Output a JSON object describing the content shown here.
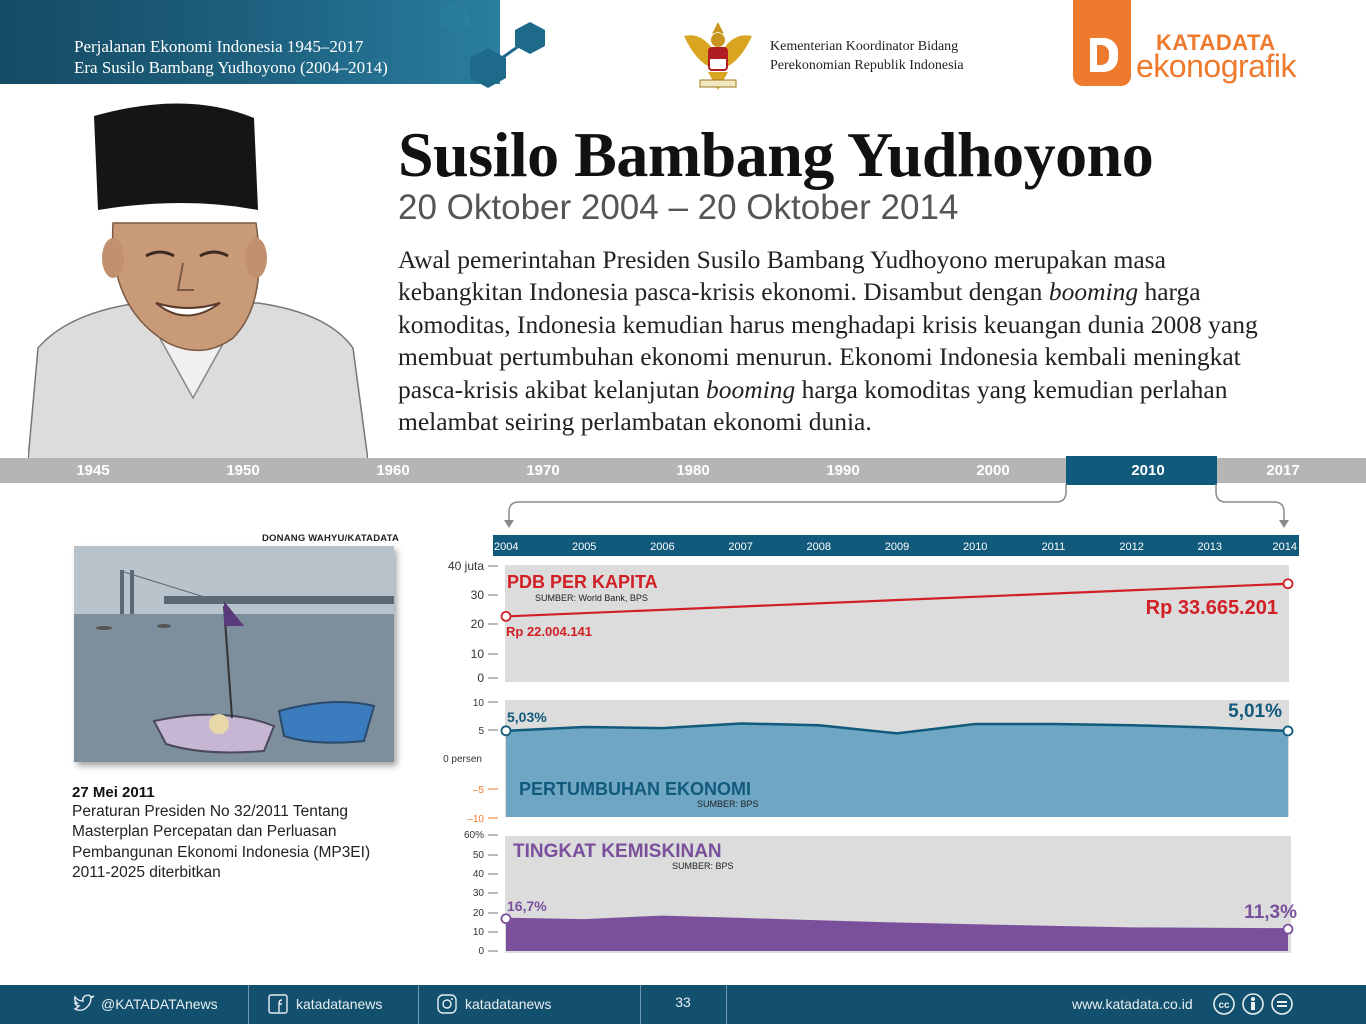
{
  "header": {
    "series_line1": "Perjalanan Ekonomi Indonesia 1945–2017",
    "series_line2": "Era Susilo Bambang Yudhoyono (2004–2014)",
    "ministry_line1": "Kementerian Koordinator Bidang",
    "ministry_line2": "Perekonomian Republik Indonesia",
    "logo_word1": "KATADATA",
    "logo_word2": "ekonografik",
    "brand_color": "#ee7a2d"
  },
  "hero": {
    "name": "Susilo Bambang Yudhoyono",
    "dates": "20 Oktober 2004 – 20 Oktober 2014",
    "intro_1": "Awal pemerintahan Presiden Susilo Bambang Yudhoyono merupakan masa kebangkitan Indonesia pasca-krisis ekonomi. Disambut dengan ",
    "intro_em1": "booming",
    "intro_2": " harga komoditas, Indonesia kemudian harus menghadapi krisis keuangan dunia 2008 yang membuat pertumbuhan ekonomi menurun. Ekonomi Indonesia kembali meningkat pasca-krisis akibat kelanjutan ",
    "intro_em2": "booming",
    "intro_3": " harga komoditas yang kemudian perlahan melambat seiring perlambatan ekonomi dunia."
  },
  "timeline": {
    "years": [
      "1945",
      "1950",
      "1960",
      "1970",
      "1980",
      "1990",
      "2000",
      "2010",
      "2017"
    ],
    "active": "2010"
  },
  "event": {
    "photo_credit": "DONANG WAHYU/KATADATA",
    "date": "27 Mei 2011",
    "text": "Peraturan Presiden No 32/2011 Tentang Masterplan Percepatan dan Perluasan Pembangunan Ekonomi Indonesia (MP3EI) 2011-2025 diterbitkan"
  },
  "chart_data": [
    {
      "type": "line",
      "title": "PDB PER KAPITA",
      "source": "SUMBER: World Bank, BPS",
      "x": [
        2004,
        2005,
        2006,
        2007,
        2008,
        2009,
        2010,
        2011,
        2012,
        2013,
        2014
      ],
      "start_year": 2004,
      "end_year": 2014,
      "start_value": 22004141,
      "end_value": 33665201,
      "start_label": "Rp 22.004.141",
      "end_label": "Rp 33.665.201",
      "y_ticks": [
        "40 juta",
        "30",
        "20",
        "10",
        "0"
      ],
      "ylim": [
        0,
        40000000
      ],
      "color": "#d11f26"
    },
    {
      "type": "area",
      "title": "PERTUMBUHAN EKONOMI",
      "source": "SUMBER: BPS",
      "x": [
        2004,
        2005,
        2006,
        2007,
        2008,
        2009,
        2010,
        2011,
        2012,
        2013,
        2014
      ],
      "values": [
        5.03,
        5.7,
        5.5,
        6.3,
        6.0,
        4.6,
        6.2,
        6.2,
        6.0,
        5.6,
        5.01
      ],
      "start_label": "5,03%",
      "end_label": "5,01%",
      "y_ticks": [
        "10",
        "5",
        "0 persen",
        "–5",
        "–10"
      ],
      "ylim": [
        -10,
        10
      ],
      "color": "#115a7b"
    },
    {
      "type": "area",
      "title": "TINGKAT KEMISKINAN",
      "source": "SUMBER: BPS",
      "x": [
        2004,
        2005,
        2006,
        2007,
        2008,
        2009,
        2010,
        2011,
        2012,
        2013,
        2014
      ],
      "values": [
        16.7,
        16.0,
        17.8,
        16.6,
        15.4,
        14.2,
        13.3,
        12.5,
        11.7,
        11.5,
        11.3
      ],
      "start_label": "16,7%",
      "end_label": "11,3%",
      "y_ticks": [
        "60%",
        "50",
        "40",
        "30",
        "20",
        "10",
        "0"
      ],
      "ylim": [
        0,
        60
      ],
      "color": "#7a4f9b"
    }
  ],
  "chart_axis_years": [
    "2004",
    "2005",
    "2006",
    "2007",
    "2008",
    "2009",
    "2010",
    "2011",
    "2012",
    "2013",
    "2014"
  ],
  "footer": {
    "twitter": "@KATADATAnews",
    "facebook": "katadatanews",
    "instagram": "katadatanews",
    "page": "33",
    "website": "www.katadata.co.id"
  }
}
